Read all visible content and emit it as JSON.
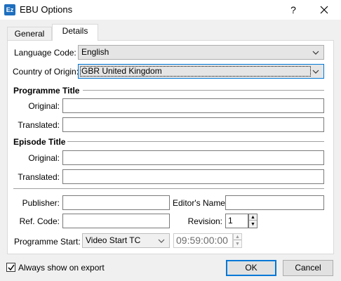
{
  "window": {
    "icon_label": "Ez",
    "title": "EBU Options",
    "help_label": "?",
    "close_label": "✕"
  },
  "tabs": [
    {
      "label": "General"
    },
    {
      "label": "Details"
    }
  ],
  "details": {
    "language_code": {
      "label": "Language Code:",
      "value": "English"
    },
    "country_of_origin": {
      "label": "Country of Origin:",
      "value": "GBR United Kingdom"
    },
    "programme_title": {
      "heading": "Programme Title",
      "original_label": "Original:",
      "original_value": "",
      "translated_label": "Translated:",
      "translated_value": ""
    },
    "episode_title": {
      "heading": "Episode Title",
      "original_label": "Original:",
      "original_value": "",
      "translated_label": "Translated:",
      "translated_value": ""
    },
    "publisher": {
      "label": "Publisher:",
      "value": ""
    },
    "editors_name": {
      "label": "Editor's Name:",
      "value": ""
    },
    "ref_code": {
      "label": "Ref. Code:",
      "value": ""
    },
    "revision": {
      "label": "Revision:",
      "value": "1"
    },
    "programme_start": {
      "label": "Programme Start:",
      "value": "Video Start TC",
      "timecode": "09:59:00:00"
    }
  },
  "footer": {
    "always_show_label": "Always show on export",
    "always_show_checked": true,
    "ok_label": "OK",
    "cancel_label": "Cancel"
  }
}
